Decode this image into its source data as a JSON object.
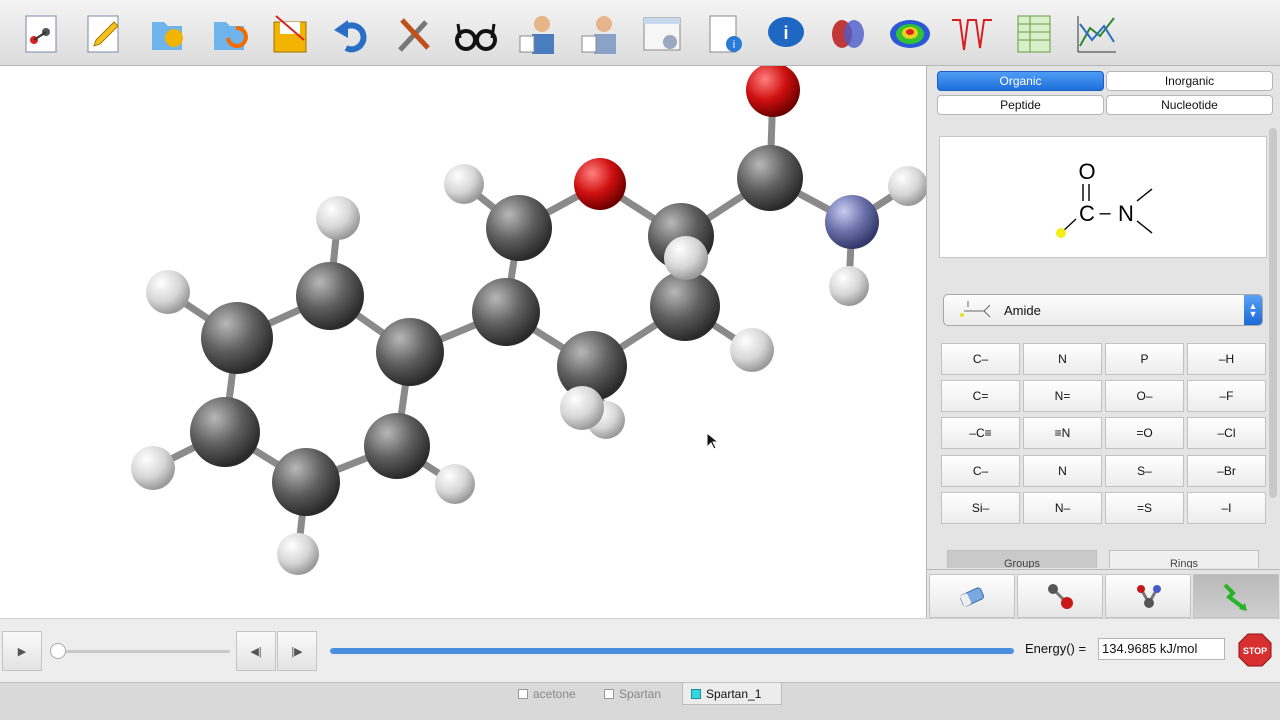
{
  "toolbar": {
    "icons": [
      "new-molecule-icon",
      "edit-icon",
      "open-icon",
      "open-recent-icon",
      "save-icon",
      "undo-icon",
      "tools-icon",
      "view-glasses-icon",
      "calculations-icon",
      "setup-surfaces-icon",
      "display-settings-icon",
      "properties-icon",
      "info-icon",
      "orbital-icon",
      "potential-map-icon",
      "spectra-icon",
      "spreadsheet-icon",
      "plot-icon"
    ]
  },
  "panel": {
    "library_tabs": [
      "Organic",
      "Inorganic",
      "Peptide",
      "Nucleotide"
    ],
    "active_tab": "Organic",
    "preview": {
      "atom_o": "O",
      "atom_c": "C",
      "bond": "–",
      "atom_n": "N"
    },
    "group_select": {
      "value": "Amide"
    },
    "fragments": [
      "C–",
      "N",
      "P",
      "–H",
      "C=",
      "N=",
      "O–",
      "–F",
      "–C≡",
      "≡N",
      "=O",
      "–Cl",
      "C–",
      "N",
      "S–",
      "–Br",
      "Si–",
      "N–",
      "=S",
      "–I"
    ],
    "sub_tabs": [
      "Groups",
      "Rings"
    ],
    "modes": [
      "eraser-icon",
      "bond-icon",
      "multi-bond-icon",
      "build-minimize-icon"
    ]
  },
  "controls": {
    "play": "▶",
    "step_back": "◀|",
    "step_forward": "|▶",
    "slider_position": 0,
    "progress_fraction": 1.0,
    "energy_label": "Energy() =",
    "energy_value": "134.9685 kJ/mol",
    "stop_label": "STOP"
  },
  "documents": {
    "tabs": [
      {
        "label": "acetone",
        "active": false
      },
      {
        "label": "Spartan",
        "active": false
      },
      {
        "label": "Spartan_1",
        "active": true
      }
    ]
  },
  "colors": {
    "accent": "#2a7be4",
    "carbon": "#5a5a5a",
    "oxygen": "#cc1010",
    "nitrogen": "#6a6fa8",
    "hydrogen": "#e8e8e8"
  }
}
